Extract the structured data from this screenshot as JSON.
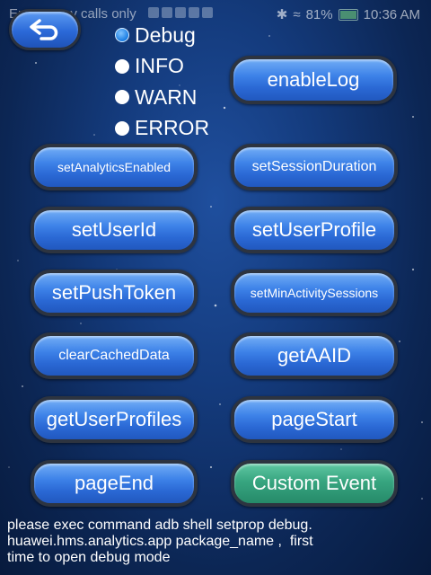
{
  "status_bar": {
    "carrier_text": "Emergency calls only",
    "battery_percent": "81%",
    "time": "10:36 AM"
  },
  "back_button": {
    "icon": "back-arrow-icon"
  },
  "log_levels": {
    "options": [
      "Debug",
      "INFO",
      "WARN",
      "ERROR"
    ],
    "selected": "Debug"
  },
  "buttons": {
    "enable_log": "enableLog",
    "set_analytics_enabled": "setAnalyticsEnabled",
    "set_session_duration": "setSessionDuration",
    "set_user_id": "setUserId",
    "set_user_profile": "setUserProfile",
    "set_push_token": "setPushToken",
    "set_min_activity_sessions": "setMinActivitySessions",
    "clear_cached_data": "clearCachedData",
    "get_aaid": "getAAID",
    "get_user_profiles": "getUserProfiles",
    "page_start": "pageStart",
    "page_end": "pageEnd",
    "custom_event": "Custom Event"
  },
  "footer": {
    "line1": "please exec command adb shell setprop debug.",
    "line2": "huawei.hms.analytics.app package_name ,  first",
    "line3": "time to open debug mode"
  },
  "colors": {
    "button_blue": "#3d82e8",
    "button_green": "#37a580",
    "background": "#143b7d"
  }
}
